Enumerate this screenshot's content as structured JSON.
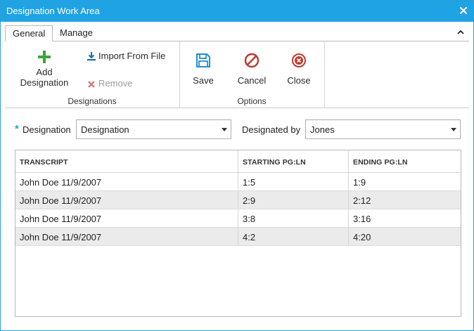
{
  "window": {
    "title": "Designation Work Area"
  },
  "ribbon": {
    "tabs": [
      "General",
      "Manage"
    ],
    "designations_group": {
      "label": "Designations",
      "add_label_line1": "Add",
      "add_label_line2": "Designation",
      "import_label": "Import From File",
      "remove_label": "Remove"
    },
    "options_group": {
      "label": "Options",
      "save_label": "Save",
      "cancel_label": "Cancel",
      "close_label": "Close"
    }
  },
  "form": {
    "required_marker": "*",
    "designation_label": "Designation",
    "designation_value": "Designation",
    "designated_by_label": "Designated by",
    "designated_by_value": "Jones"
  },
  "grid": {
    "columns": [
      "TRANSCRIPT",
      "STARTING PG:LN",
      "ENDING PG:LN"
    ],
    "rows": [
      [
        "John Doe 11/9/2007",
        "1:5",
        "1:9"
      ],
      [
        "John Doe 11/9/2007",
        "2:9",
        "2:12"
      ],
      [
        "John Doe 11/9/2007",
        "3:8",
        "3:16"
      ],
      [
        "John Doe 11/9/2007",
        "4:2",
        "4:20"
      ]
    ]
  },
  "colors": {
    "titlebar": "#1fa3e4",
    "add_icon": "#3aa63a",
    "save_icon": "#1f8fd6",
    "cancel_icon": "#c0392b",
    "close_icon": "#c0392b",
    "remove_icon": "#d77b7b"
  },
  "icons": [
    "close-icon",
    "collapse-icon",
    "plus-icon",
    "download-icon",
    "remove-x-icon",
    "floppy-disk-icon",
    "no-entry-icon",
    "close-circle-icon",
    "dropdown-arrow-icon"
  ]
}
